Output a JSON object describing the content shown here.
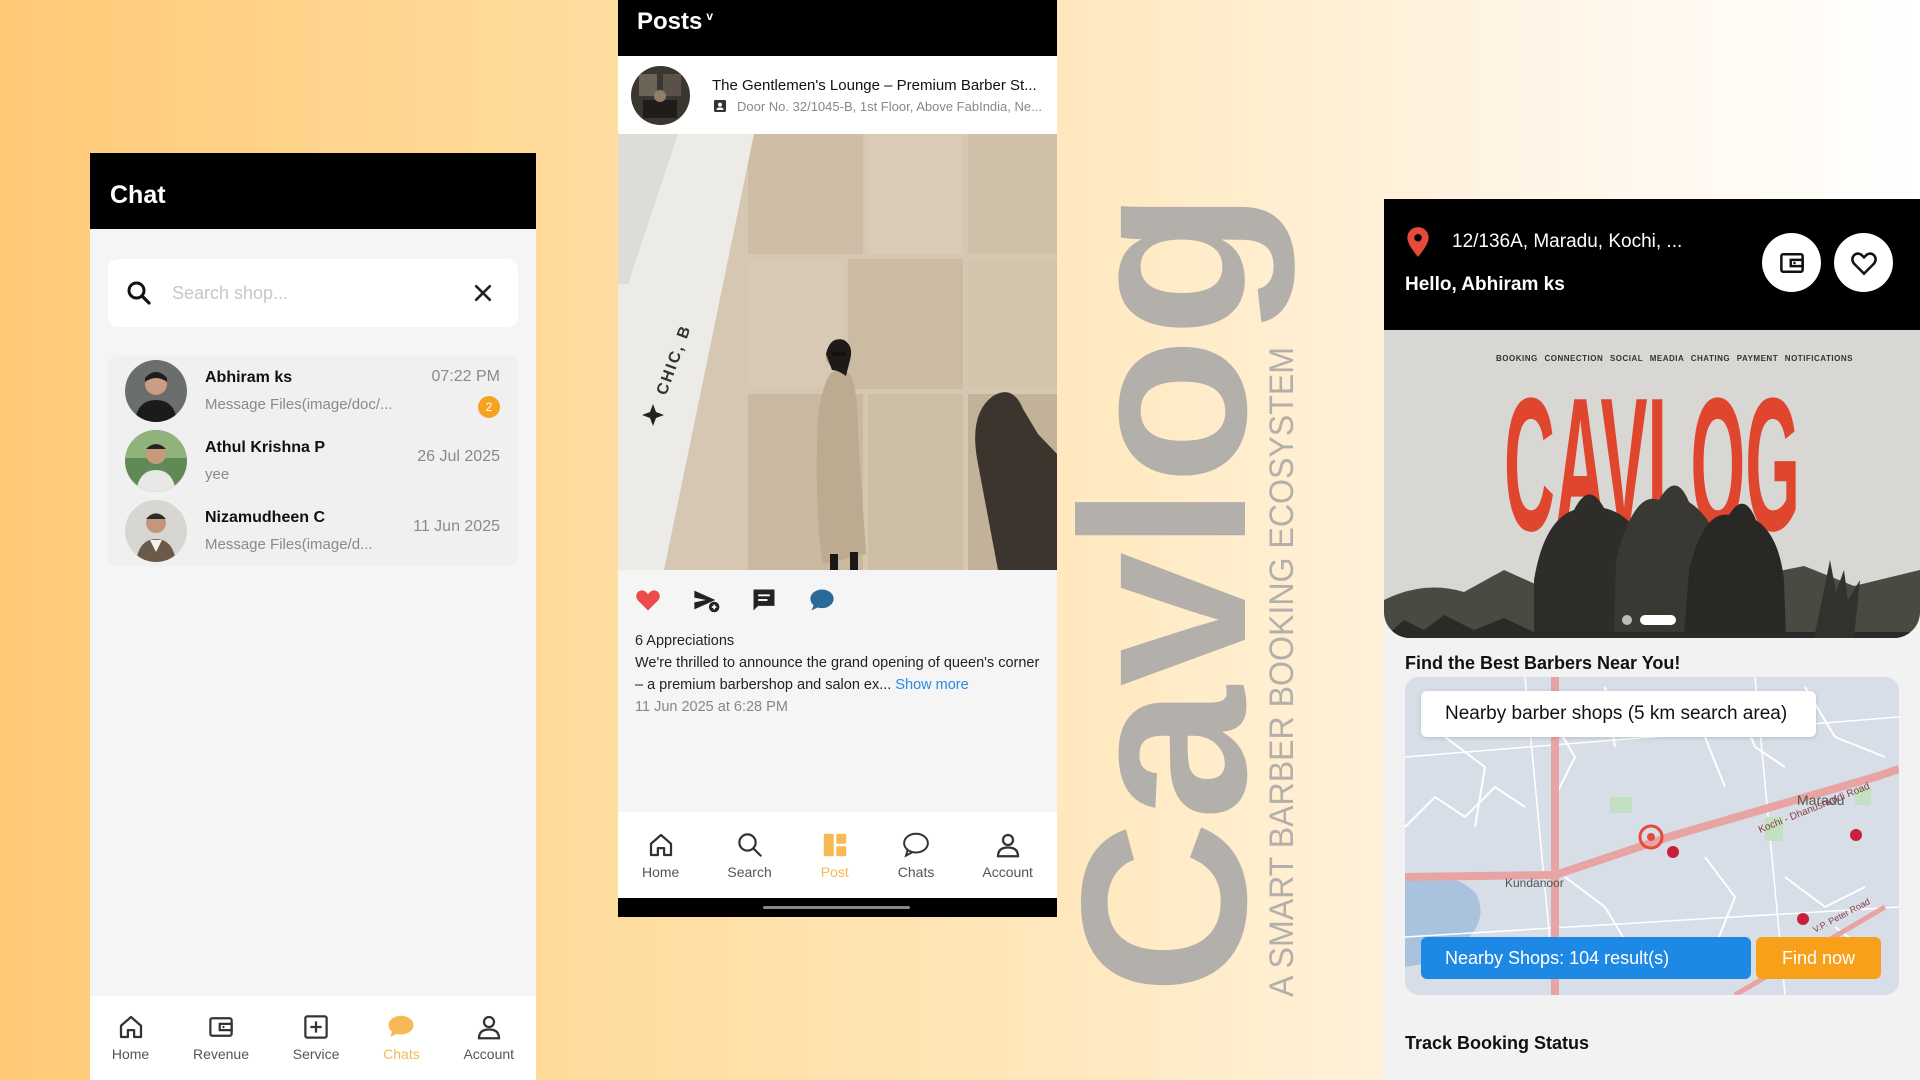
{
  "chat_app": {
    "title": "Chat",
    "search_placeholder": "Search shop...",
    "conversations": [
      {
        "name": "Abhiram ks",
        "message": "Message Files(image/doc/...",
        "time": "07:22 PM",
        "unread": "2"
      },
      {
        "name": "Athul Krishna P",
        "message": "yee",
        "time": "26 Jul 2025",
        "unread": ""
      },
      {
        "name": "Nizamudheen C",
        "message": "Message Files(image/d...",
        "time": "11 Jun 2025",
        "unread": ""
      }
    ],
    "nav": [
      {
        "label": "Home",
        "icon": "home-icon"
      },
      {
        "label": "Revenue",
        "icon": "wallet-icon"
      },
      {
        "label": "Service",
        "icon": "plus-square-icon"
      },
      {
        "label": "Chats",
        "icon": "chat-bubble-icon",
        "active": true
      },
      {
        "label": "Account",
        "icon": "person-icon"
      }
    ],
    "accent": "#f7b955"
  },
  "posts_app": {
    "title": "Posts",
    "title_caret": "v",
    "shop_name": "The Gentlemen's Lounge – Premium Barber St...",
    "shop_address": "Door No. 32/1045-B, 1st Floor, Above FabIndia, Ne...",
    "image_text": "CHIC, B",
    "appreciations": "6 Appreciations",
    "caption": "We're thrilled to announce the grand opening of queen's corner – a premium barbershop and salon ex...",
    "show_more": "Show more",
    "date": "11 Jun 2025 at 6:28 PM",
    "nav": [
      {
        "label": "Home",
        "icon": "home-icon"
      },
      {
        "label": "Search",
        "icon": "search-icon"
      },
      {
        "label": "Post",
        "icon": "grid-icon",
        "active": true
      },
      {
        "label": "Chats",
        "icon": "chat-bubble-icon"
      },
      {
        "label": "Account",
        "icon": "person-icon"
      }
    ],
    "like_color": "#ef4b4b"
  },
  "branding": {
    "wordmark": "Cavlog",
    "tagline": "A SMART BARBER BOOKING ECOSYSTEM",
    "color": "#b3afaa"
  },
  "home_app": {
    "location": "12/136A, Maradu, Kochi, ...",
    "greeting": "Hello, Abhiram ks",
    "banner_tags": "BOOKING CONNECTION SOCIAL MEADIA CHATING PAYMENT NOTIFICATIONS",
    "banner_word": "CAVLOG",
    "banner_color": "#e0452e",
    "nearby_title": "Find the Best Barbers Near You!",
    "map_chip": "Nearby barber shops (5 km search area)",
    "map_labels": {
      "maradu": "Maradu",
      "kundanoor": "Kundanoor",
      "road1": "Kochi - Dhanushkodi Road",
      "road2": "V.P. Peter Road"
    },
    "result_text": "Nearby Shops: 104 result(s)",
    "find_button": "Find now",
    "track_title": "Track Booking Status"
  }
}
